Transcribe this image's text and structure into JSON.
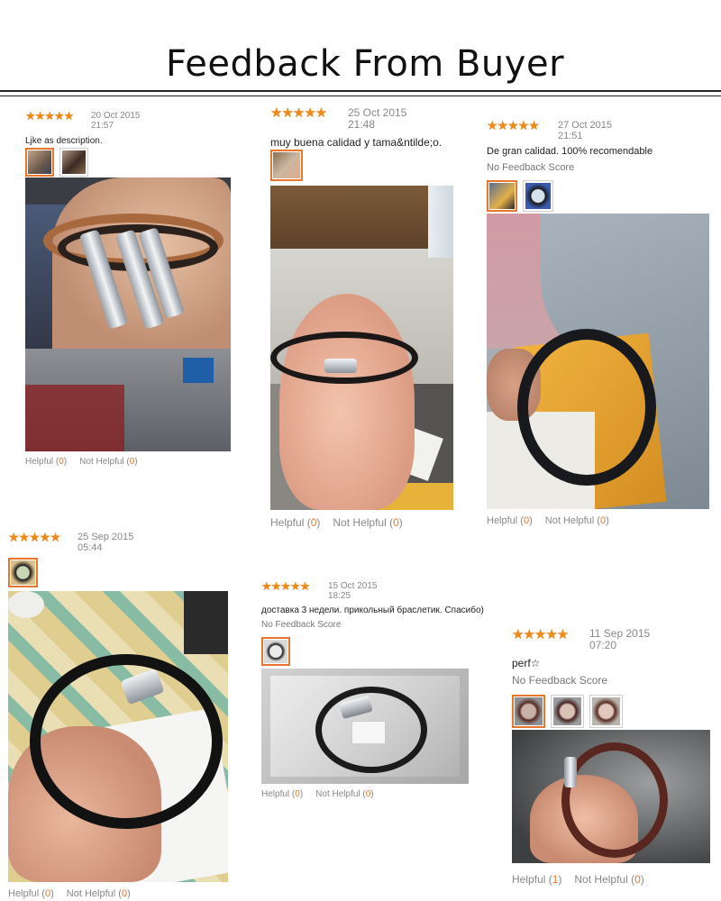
{
  "header": {
    "title": "Feedback From Buyer"
  },
  "star_glyphs": "★★★★★",
  "colors": {
    "accent": "#e8762d",
    "star": "#f08a16"
  },
  "reviews": [
    {
      "date": "20 Oct 2015",
      "time": "21:57",
      "comment": "Ljke as description.",
      "no_feedback": "",
      "helpful_label": "Helpful",
      "helpful_count": "0",
      "not_helpful_label": "Not Helpful",
      "not_helpful_count": "0"
    },
    {
      "date": "25 Oct 2015",
      "time": "21:48",
      "comment": "muy buena calidad y tama&ntilde;o.",
      "no_feedback": "",
      "helpful_label": "Helpful",
      "helpful_count": "0",
      "not_helpful_label": "Not Helpful",
      "not_helpful_count": "0"
    },
    {
      "date": "27 Oct 2015",
      "time": "21:51",
      "comment": "De gran calidad. 100% recomendable",
      "no_feedback": "No Feedback Score",
      "helpful_label": "Helpful",
      "helpful_count": "0",
      "not_helpful_label": "Not Helpful",
      "not_helpful_count": "0"
    },
    {
      "date": "25 Sep 2015",
      "time": "05:44",
      "comment": "",
      "no_feedback": "",
      "helpful_label": "Helpful",
      "helpful_count": "0",
      "not_helpful_label": "Not Helpful",
      "not_helpful_count": "0"
    },
    {
      "date": "15 Oct 2015",
      "time": "18:25",
      "comment": "доставка 3 недели. прикольный браслетик. Спасибо)",
      "no_feedback": "No Feedback Score",
      "helpful_label": "Helpful",
      "helpful_count": "0",
      "not_helpful_label": "Not Helpful",
      "not_helpful_count": "0"
    },
    {
      "date": "11 Sep 2015",
      "time": "07:20",
      "comment": "perf☆",
      "no_feedback": "No Feedback Score",
      "helpful_label": "Helpful",
      "helpful_count": "1",
      "not_helpful_label": "Not Helpful",
      "not_helpful_count": "0"
    }
  ]
}
